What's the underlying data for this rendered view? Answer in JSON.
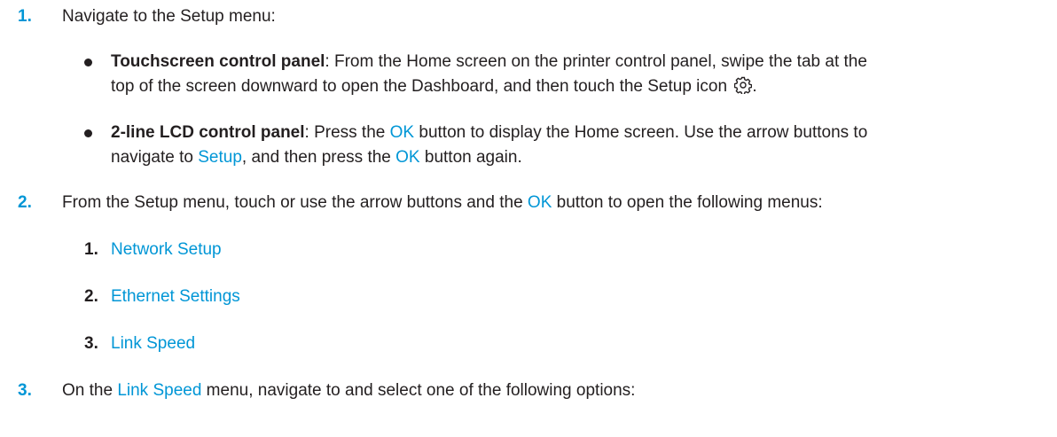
{
  "steps": [
    {
      "num": "1.",
      "text": "Navigate to the Setup menu:",
      "bullets": [
        {
          "title": "Touchscreen control panel",
          "line1": ": From the Home screen on the printer control panel, swipe the tab at the",
          "line2": "top of the screen downward to open the Dashboard, and then touch the Setup icon ",
          "line2_end": ".",
          "icon": "gear-icon"
        },
        {
          "title": "2-line LCD control panel",
          "line1_a": ": Press the ",
          "ok": "OK",
          "line1_b": " button to display the Home screen. Use the arrow buttons to",
          "line2_a": "navigate to ",
          "setup": "Setup",
          "line2_b": ", and then press the ",
          "line2_ok": "OK",
          "line2_c": " button again."
        }
      ]
    },
    {
      "num": "2.",
      "text_a": "From the Setup menu, touch or use the arrow buttons and the ",
      "ok": "OK",
      "text_b": " button to open the following menus:",
      "substeps": [
        {
          "num": "1.",
          "label": "Network Setup"
        },
        {
          "num": "2.",
          "label": "Ethernet Settings"
        },
        {
          "num": "3.",
          "label": "Link Speed"
        }
      ]
    },
    {
      "num": "3.",
      "text_a": "On the ",
      "link": "Link Speed",
      "text_b": " menu, navigate to and select one of the following options:"
    }
  ]
}
